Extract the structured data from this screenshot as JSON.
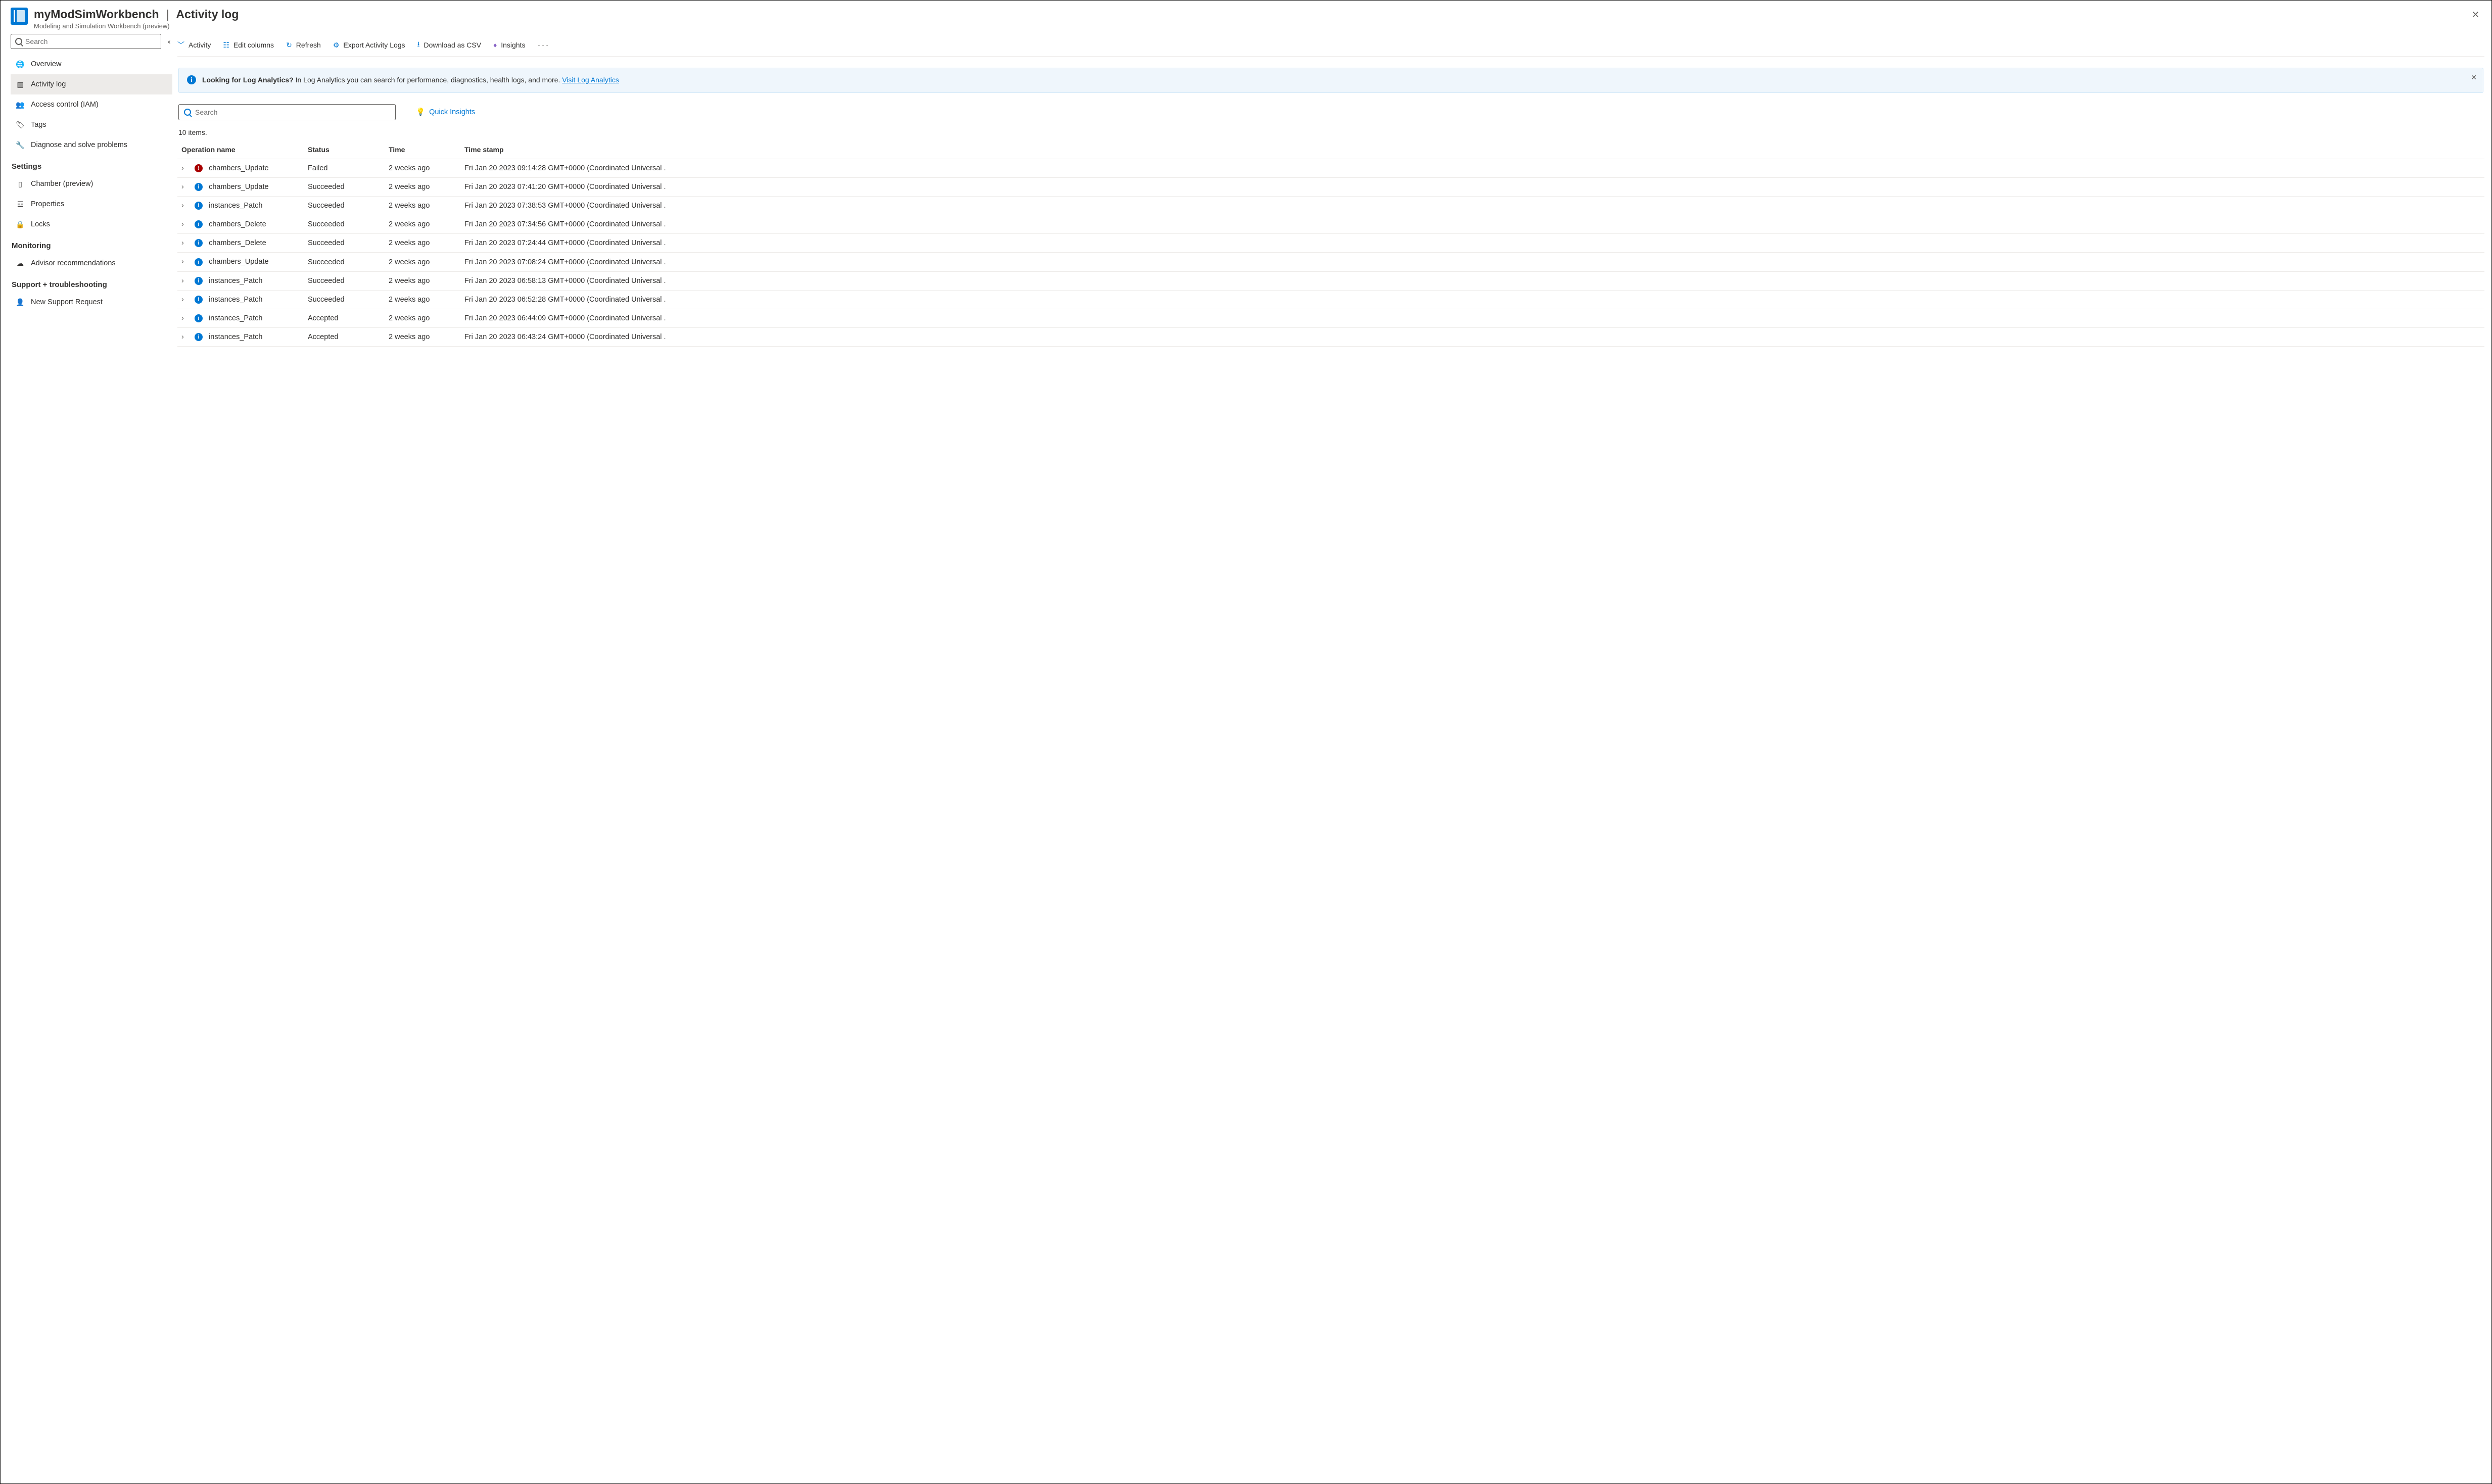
{
  "header": {
    "resource_name": "myModSimWorkbench",
    "section": "Activity log",
    "subtitle": "Modeling and Simulation Workbench (preview)"
  },
  "sidebar": {
    "search_placeholder": "Search",
    "items": [
      {
        "label": "Overview",
        "icon": "globe-icon"
      },
      {
        "label": "Activity log",
        "icon": "log-icon",
        "active": true
      },
      {
        "label": "Access control (IAM)",
        "icon": "people-icon"
      },
      {
        "label": "Tags",
        "icon": "tag-icon"
      },
      {
        "label": "Diagnose and solve problems",
        "icon": "wrench-icon"
      }
    ],
    "groups": [
      {
        "header": "Settings",
        "items": [
          {
            "label": "Chamber (preview)",
            "icon": "chamber-icon"
          },
          {
            "label": "Properties",
            "icon": "properties-icon"
          },
          {
            "label": "Locks",
            "icon": "lock-icon"
          }
        ]
      },
      {
        "header": "Monitoring",
        "items": [
          {
            "label": "Advisor recommendations",
            "icon": "advisor-icon"
          }
        ]
      },
      {
        "header": "Support + troubleshooting",
        "items": [
          {
            "label": "New Support Request",
            "icon": "support-icon"
          }
        ]
      }
    ]
  },
  "toolbar": {
    "activity": "Activity",
    "edit_columns": "Edit columns",
    "refresh": "Refresh",
    "export": "Export Activity Logs",
    "download_csv": "Download as CSV",
    "insights": "Insights"
  },
  "banner": {
    "title": "Looking for Log Analytics?",
    "body": "In Log Analytics you can search for performance, diagnostics, health logs, and more.",
    "link_text": "Visit Log Analytics"
  },
  "log_search_placeholder": "Search",
  "quick_insights_label": "Quick Insights",
  "items_count_label": "10 items.",
  "columns": {
    "operation": "Operation name",
    "status": "Status",
    "time": "Time",
    "timestamp": "Time stamp"
  },
  "rows": [
    {
      "op": "chambers_Update",
      "status": "Failed",
      "status_kind": "failed",
      "time": "2 weeks ago",
      "ts": "Fri Jan 20 2023 09:14:28 GMT+0000 (Coordinated Universal ."
    },
    {
      "op": "chambers_Update",
      "status": "Succeeded",
      "status_kind": "info",
      "time": "2 weeks ago",
      "ts": "Fri Jan 20 2023 07:41:20 GMT+0000 (Coordinated Universal ."
    },
    {
      "op": "instances_Patch",
      "status": "Succeeded",
      "status_kind": "info",
      "time": "2 weeks ago",
      "ts": "Fri Jan 20 2023 07:38:53 GMT+0000 (Coordinated Universal ."
    },
    {
      "op": "chambers_Delete",
      "status": "Succeeded",
      "status_kind": "info",
      "time": "2 weeks ago",
      "ts": "Fri Jan 20 2023 07:34:56 GMT+0000 (Coordinated Universal ."
    },
    {
      "op": "chambers_Delete",
      "status": "Succeeded",
      "status_kind": "info",
      "time": "2 weeks ago",
      "ts": "Fri Jan 20 2023 07:24:44 GMT+0000 (Coordinated Universal ."
    },
    {
      "op": "chambers_Update",
      "status": "Succeeded",
      "status_kind": "info",
      "time": "2 weeks ago",
      "ts": "Fri Jan 20 2023 07:08:24 GMT+0000 (Coordinated Universal ."
    },
    {
      "op": "instances_Patch",
      "status": "Succeeded",
      "status_kind": "info",
      "time": "2 weeks ago",
      "ts": "Fri Jan 20 2023 06:58:13 GMT+0000 (Coordinated Universal ."
    },
    {
      "op": "instances_Patch",
      "status": "Succeeded",
      "status_kind": "info",
      "time": "2 weeks ago",
      "ts": "Fri Jan 20 2023 06:52:28 GMT+0000 (Coordinated Universal ."
    },
    {
      "op": "instances_Patch",
      "status": "Accepted",
      "status_kind": "info",
      "time": "2 weeks ago",
      "ts": "Fri Jan 20 2023 06:44:09 GMT+0000 (Coordinated Universal ."
    },
    {
      "op": "instances_Patch",
      "status": "Accepted",
      "status_kind": "info",
      "time": "2 weeks ago",
      "ts": "Fri Jan 20 2023 06:43:24 GMT+0000 (Coordinated Universal ."
    }
  ],
  "icons": {
    "globe-icon": "🌐",
    "log-icon": "▥",
    "people-icon": "👥",
    "tag-icon": "🏷",
    "wrench-icon": "🔧",
    "chamber-icon": "▯",
    "properties-icon": "☲",
    "lock-icon": "🔒",
    "advisor-icon": "☁",
    "support-icon": "👤"
  }
}
